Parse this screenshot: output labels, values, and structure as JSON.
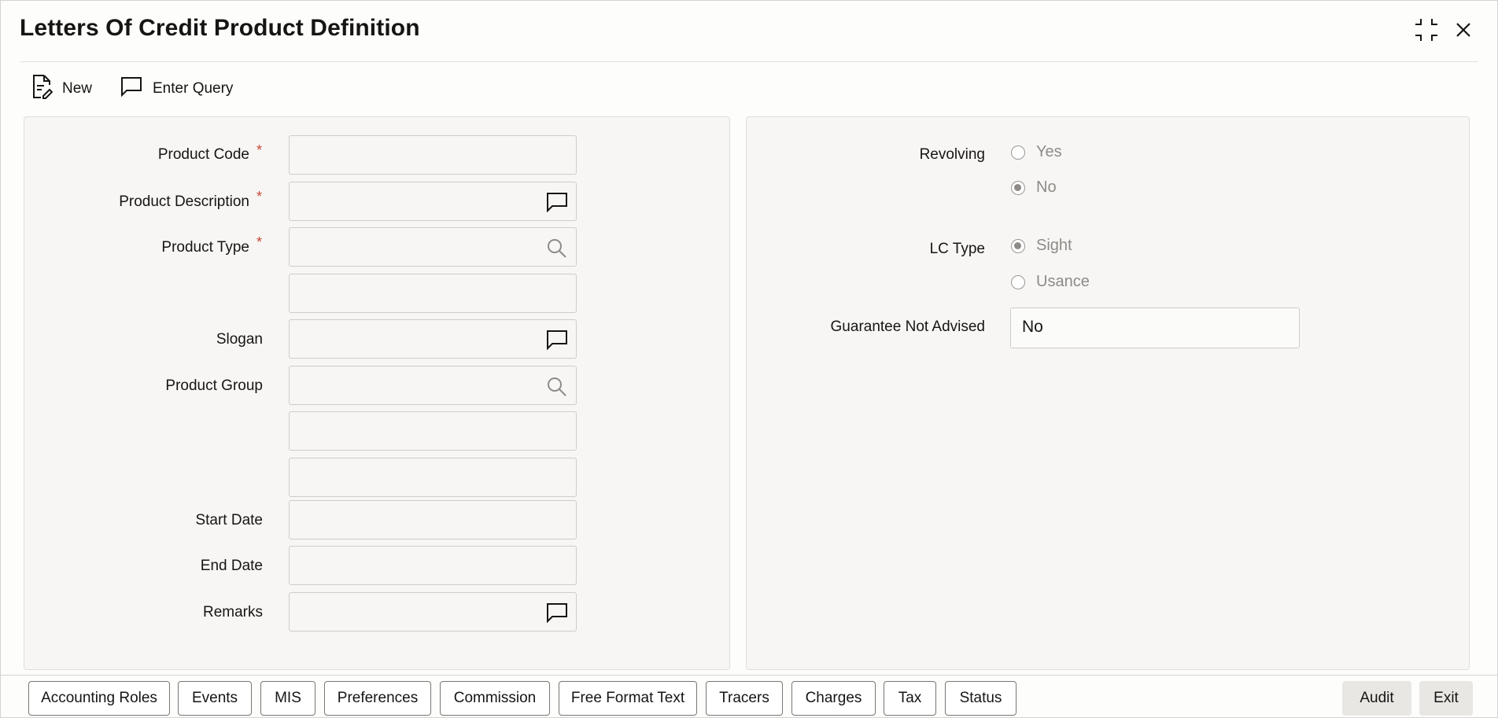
{
  "window": {
    "title": "Letters Of Credit Product Definition"
  },
  "toolbar": {
    "new_label": "New",
    "enter_query_label": "Enter Query"
  },
  "left_form": {
    "product_code_label": "Product Code",
    "product_description_label": "Product Description",
    "product_type_label": "Product Type",
    "slogan_label": "Slogan",
    "product_group_label": "Product Group",
    "start_date_label": "Start Date",
    "end_date_label": "End Date",
    "remarks_label": "Remarks",
    "required_marker": "*"
  },
  "right_form": {
    "revolving_label": "Revolving",
    "revolving_options": [
      "Yes",
      "No"
    ],
    "revolving_selected": "No",
    "lc_type_label": "LC Type",
    "lc_type_options": [
      "Sight",
      "Usance"
    ],
    "lc_type_selected": "Sight",
    "guarantee_not_advised_label": "Guarantee Not Advised",
    "guarantee_not_advised_value": "No"
  },
  "bottom_tabs": [
    "Accounting Roles",
    "Events",
    "MIS",
    "Preferences",
    "Commission",
    "Free Format Text",
    "Tracers",
    "Charges",
    "Tax",
    "Status"
  ],
  "actions": {
    "audit_label": "Audit",
    "exit_label": "Exit"
  },
  "colors": {
    "required": "#c74634",
    "panel_bg": "#f7f6f4",
    "text": "#161513",
    "disabled_text": "#8e8b87"
  }
}
